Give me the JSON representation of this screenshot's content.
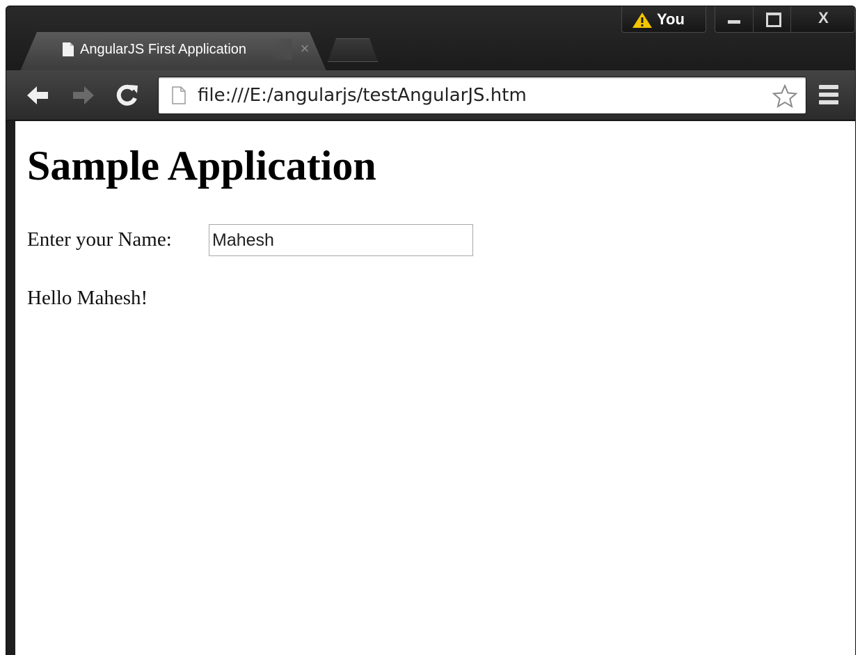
{
  "browser": {
    "tab": {
      "title": "AngularJS First Application",
      "icon": "document-icon",
      "close_icon": "close-icon"
    },
    "profile": {
      "label": "You",
      "icon": "warning-icon"
    },
    "window_controls": {
      "minimize": "minimize-icon",
      "maximize": "maximize-icon",
      "close": "X"
    },
    "toolbar": {
      "back_icon": "arrow-left-icon",
      "forward_icon": "arrow-right-icon",
      "reload_icon": "reload-icon",
      "url": "file:///E:/angularjs/testAngularJS.htm",
      "bookmark_icon": "star-icon",
      "menu_icon": "hamburger-menu-icon"
    }
  },
  "page": {
    "title": "Sample Application",
    "name_label": "Enter your Name:",
    "name_value": "Mahesh",
    "greeting": "Hello Mahesh!"
  },
  "colors": {
    "chrome_dark": "#1e1e1e",
    "warning": "#f5c400",
    "page_bg": "#ffffff"
  }
}
